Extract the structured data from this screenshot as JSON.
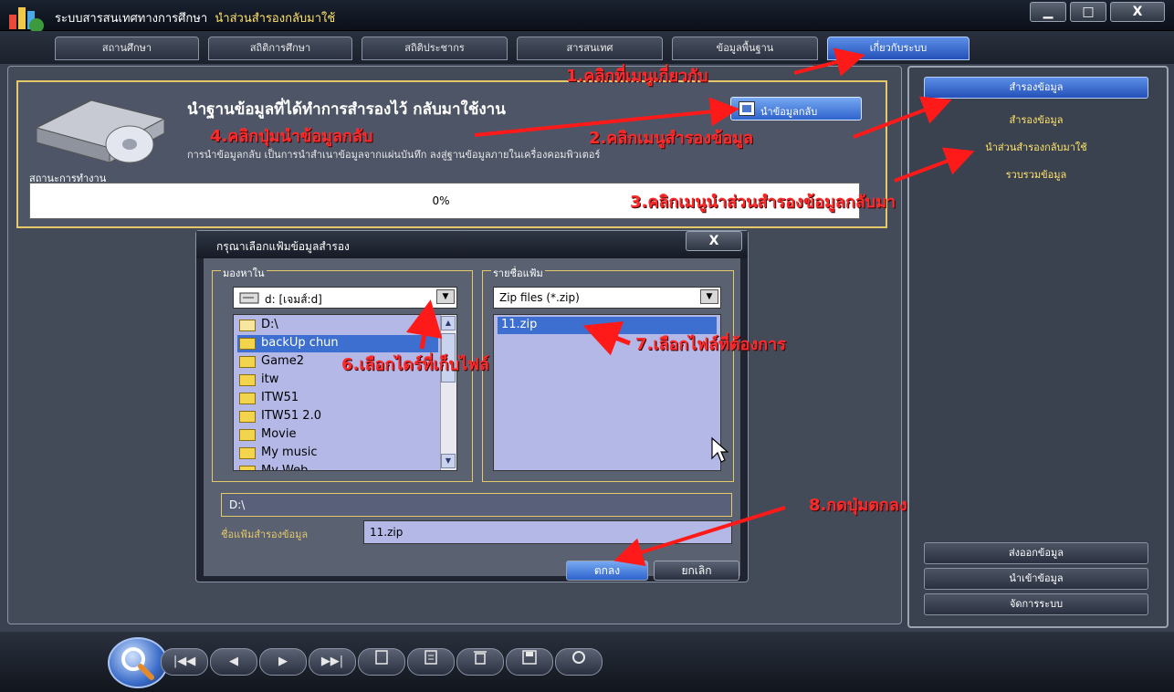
{
  "window": {
    "title": "ระบบสารสนเทศทางการศึกษา",
    "subtitle": "นำส่วนสำรองกลับมาใช้",
    "controls": [
      "▁",
      "□",
      "X"
    ]
  },
  "tabs": [
    {
      "label": "สถานศึกษา"
    },
    {
      "label": "สถิติการศึกษา"
    },
    {
      "label": "สถิติประชากร"
    },
    {
      "label": "สารสนเทศ"
    },
    {
      "label": "ข้อมูลพื้นฐาน"
    },
    {
      "label": "เกี่ยวกับระบบ",
      "active": true
    }
  ],
  "restore": {
    "title": "นำฐานข้อมูลที่ได้ทำการสำรองไว้ กลับมาใช้งาน",
    "description": "การนำข้อมูลกลับ เป็นการนำสำเนาข้อมูลจากแผ่นบันทึก ลงสู่ฐานข้อมูลภายในเครื่องคอมพิวเตอร์",
    "status_label": "สถานะการทำงาน",
    "button_label": "นำข้อมูลกลับ",
    "progress": "0%",
    "progress_value": 0
  },
  "dialog": {
    "title": "กรุณาเลือกแฟ้มข้อมูลสำรอง",
    "close_label": "X",
    "look_in_label": "มองหาใน",
    "drive_value": "d: [เจมส์:d]",
    "folders": [
      "D:\\",
      "backUp chun",
      "Game2",
      "itw",
      "ITW51",
      "ITW51 2.0",
      "Movie",
      "My music",
      "My Web"
    ],
    "selected_folder": "backUp chun",
    "file_list_label": "รายชื่อแฟ้ม",
    "file_type_value": "Zip files (*.zip)",
    "files": [
      "11.zip"
    ],
    "current_path": "D:\\",
    "filename_label": "ชื่อแฟ้มสำรองข้อมูล",
    "filename_value": "11.zip",
    "ok_label": "ตกลง",
    "cancel_label": "ยกเลิก"
  },
  "right_panel": {
    "header": "สำรองข้อมูล",
    "links": [
      "สำรองข้อมูล",
      "นำส่วนสำรองกลับมาใช้",
      "รวบรวมข้อมูล"
    ],
    "bottom_buttons": [
      "ส่งออกข้อมูล",
      "นำเข้าข้อมูล",
      "จัดการระบบ"
    ]
  },
  "toolbar": {
    "buttons": [
      "|◀◀",
      "◀",
      "▶",
      "▶▶|",
      "new-doc",
      "doc",
      "trash",
      "save",
      "refresh"
    ],
    "search_icon": "search-icon"
  },
  "annotations": [
    "1.คลิกที่เมนูเกี่ยวกับ",
    "2.คลิกเมนูสำรองข้อมูล",
    "3.คลิกเมนูนำส่วนสำรองข้อมูลกลับมา",
    "4.คลิกปุ่มนำข้อมูลกลับ",
    "6.เลือกไดร์ที่เก็บไฟล์",
    "7.เลือกไฟล์ที่ต้องการ",
    "8.กดปุ่มตกลง"
  ],
  "colors": {
    "accent_blue": "#2e63cc",
    "gold_border": "#e5c86a",
    "annotation_red": "#ff2a2a",
    "link_yellow": "#ffe36a"
  }
}
